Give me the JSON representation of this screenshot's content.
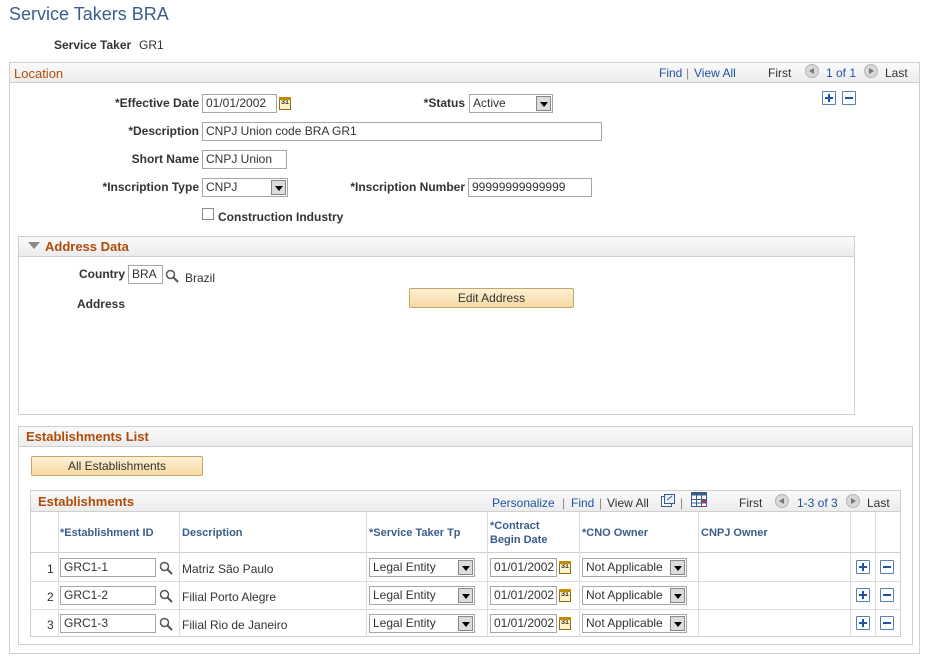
{
  "page": {
    "title": "Service Takers BRA",
    "service_taker_label": "Service Taker",
    "service_taker_value": "GR1"
  },
  "location": {
    "title": "Location",
    "find": "Find",
    "view_all": "View All",
    "first": "First",
    "count": "1 of 1",
    "last": "Last",
    "effective_date_label": "*Effective Date",
    "effective_date_value": "01/01/2002",
    "status_label": "*Status",
    "status_value": "Active",
    "description_label": "*Description",
    "description_value": "CNPJ Union code BRA GR1",
    "short_name_label": "Short Name",
    "short_name_value": "CNPJ Union",
    "inscription_type_label": "*Inscription Type",
    "inscription_type_value": "CNPJ",
    "inscription_number_label": "*Inscription Number",
    "inscription_number_value": "99999999999999",
    "construction_label": "Construction Industry",
    "construction_checked": false
  },
  "address": {
    "title": "Address Data",
    "country_label": "Country",
    "country_value": "BRA",
    "country_name": "Brazil",
    "address_label": "Address",
    "edit_button": "Edit Address"
  },
  "establishments_list": {
    "title": "Establishments List",
    "all_button": "All Establishments"
  },
  "establishments": {
    "title": "Establishments",
    "personalize": "Personalize",
    "find": "Find",
    "view_all": "View All",
    "first": "First",
    "count": "1-3 of 3",
    "last": "Last",
    "columns": {
      "id": "*Establishment ID",
      "description": "Description",
      "service_taker_tp": "*Service Taker Tp",
      "contract_1": "*Contract",
      "contract_2": "Begin Date",
      "cno_owner": "*CNO Owner",
      "cnpj_owner": "CNPJ Owner"
    },
    "rows": [
      {
        "num": "1",
        "id": "GRC1-1",
        "description": "Matriz São Paulo",
        "tp": "Legal Entity",
        "date": "01/01/2002",
        "cno": "Not Applicable"
      },
      {
        "num": "2",
        "id": "GRC1-2",
        "description": "Filial Porto Alegre",
        "tp": "Legal Entity",
        "date": "01/01/2002",
        "cno": "Not Applicable"
      },
      {
        "num": "3",
        "id": "GRC1-3",
        "description": "Filial Rio de Janeiro",
        "tp": "Legal Entity",
        "date": "01/01/2002",
        "cno": "Not Applicable"
      }
    ]
  },
  "icons": {
    "calendar": "calendar-icon",
    "lookup": "lookup-icon",
    "add": "add-row-icon",
    "delete": "delete-row-icon",
    "zoom": "zoom-grid-icon",
    "download": "download-grid-icon"
  },
  "colors": {
    "title": "#3b5d8c",
    "section": "#b04c08",
    "link": "#1f53a3",
    "button_bg": "#f6d9a0"
  }
}
